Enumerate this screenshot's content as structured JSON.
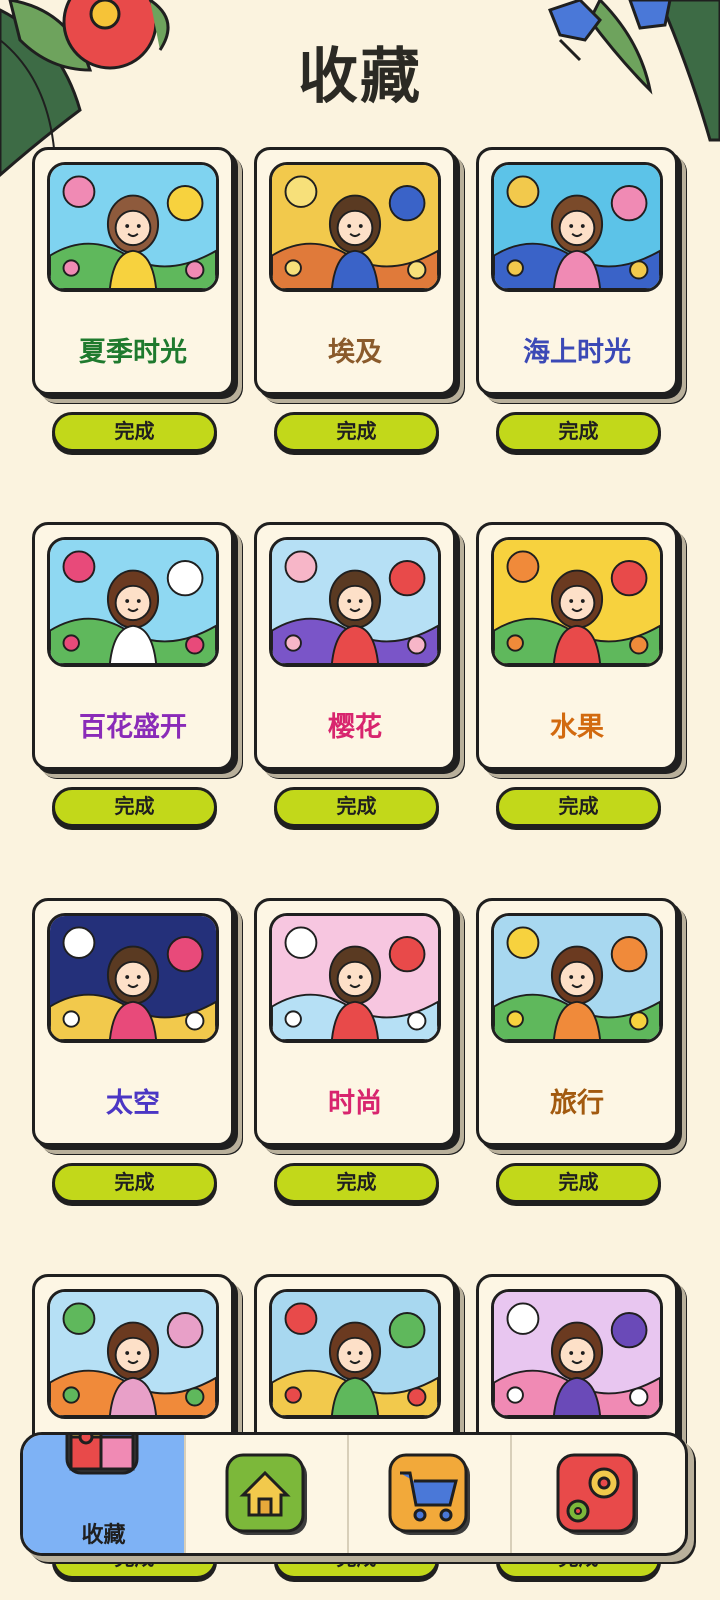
{
  "header": {
    "title": "收藏"
  },
  "albums": [
    {
      "title": "夏季时光",
      "title_color": "#1f7a2e",
      "button": "完成",
      "art": "summer"
    },
    {
      "title": "埃及",
      "title_color": "#8a5a2b",
      "button": "完成",
      "art": "egypt"
    },
    {
      "title": "海上时光",
      "title_color": "#3b49b6",
      "button": "完成",
      "art": "sea"
    },
    {
      "title": "百花盛开",
      "title_color": "#8a2bb8",
      "button": "完成",
      "art": "flowers"
    },
    {
      "title": "樱花",
      "title_color": "#d8256e",
      "button": "完成",
      "art": "sakura"
    },
    {
      "title": "水果",
      "title_color": "#d26a0f",
      "button": "完成",
      "art": "fruit"
    },
    {
      "title": "太空",
      "title_color": "#4b36c4",
      "button": "完成",
      "art": "space"
    },
    {
      "title": "时尚",
      "title_color": "#d8256e",
      "button": "完成",
      "art": "fashion"
    },
    {
      "title": "旅行",
      "title_color": "#a25a0f",
      "button": "完成",
      "art": "travel"
    },
    {
      "title": "",
      "title_color": "#1f1f1f",
      "button": "完成",
      "art": "mushroom"
    },
    {
      "title": "",
      "title_color": "#1f1f1f",
      "button": "完成",
      "art": "countryside"
    },
    {
      "title": "",
      "title_color": "#1f1f1f",
      "button": "完成",
      "art": "cafe"
    }
  ],
  "nav": {
    "items": [
      {
        "label": "收藏",
        "icon": "puzzle-icon",
        "active": true
      },
      {
        "label": "",
        "icon": "home-icon",
        "active": false
      },
      {
        "label": "",
        "icon": "cart-icon",
        "active": false
      },
      {
        "label": "",
        "icon": "gear-puzzle-icon",
        "active": false
      }
    ]
  },
  "colors": {
    "background": "#fbf3df",
    "button": "#c2d81a",
    "nav_active": "#7eb2f5"
  }
}
